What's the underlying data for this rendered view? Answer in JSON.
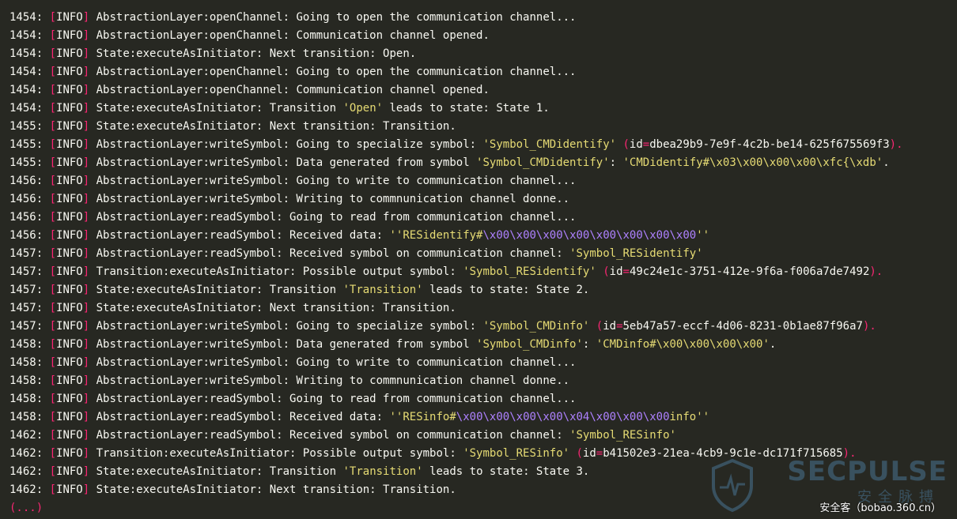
{
  "log_lines": [
    {
      "num": "1454",
      "level": "INFO",
      "segs": [
        {
          "t": "AbstractionLayer:openChannel: Going to open the communication channel...",
          "c": "plain"
        }
      ]
    },
    {
      "num": "1454",
      "level": "INFO",
      "segs": [
        {
          "t": "AbstractionLayer:openChannel: Communication channel opened.",
          "c": "plain"
        }
      ]
    },
    {
      "num": "1454",
      "level": "INFO",
      "segs": [
        {
          "t": "State:executeAsInitiator: Next transition: Open.",
          "c": "plain"
        }
      ]
    },
    {
      "num": "1454",
      "level": "INFO",
      "segs": [
        {
          "t": "AbstractionLayer:openChannel: Going to open the communication channel...",
          "c": "plain"
        }
      ]
    },
    {
      "num": "1454",
      "level": "INFO",
      "segs": [
        {
          "t": "AbstractionLayer:openChannel: Communication channel opened.",
          "c": "plain"
        }
      ]
    },
    {
      "num": "1454",
      "level": "INFO",
      "segs": [
        {
          "t": "State:executeAsInitiator: Transition ",
          "c": "plain"
        },
        {
          "t": "'Open'",
          "c": "str"
        },
        {
          "t": " leads to state: State 1.",
          "c": "plain"
        }
      ]
    },
    {
      "num": "1455",
      "level": "INFO",
      "segs": [
        {
          "t": "State:executeAsInitiator: Next transition: Transition.",
          "c": "plain"
        }
      ]
    },
    {
      "num": "1455",
      "level": "INFO",
      "segs": [
        {
          "t": "AbstractionLayer:writeSymbol: Going to specialize symbol: ",
          "c": "plain"
        },
        {
          "t": "'Symbol_CMDidentify'",
          "c": "str"
        },
        {
          "t": " (",
          "c": "par"
        },
        {
          "t": "id",
          "c": "plain"
        },
        {
          "t": "=",
          "c": "par"
        },
        {
          "t": "dbea29b9-7e9f-4c2b-be14-625f675569f3",
          "c": "plain"
        },
        {
          "t": ").",
          "c": "par"
        }
      ]
    },
    {
      "num": "1455",
      "level": "INFO",
      "segs": [
        {
          "t": "AbstractionLayer:writeSymbol: Data generated from symbol ",
          "c": "plain"
        },
        {
          "t": "'Symbol_CMDidentify'",
          "c": "str"
        },
        {
          "t": ": ",
          "c": "plain"
        },
        {
          "t": "'CMDidentify#\\x03\\x00\\x00\\x00\\xfc{\\xdb'",
          "c": "str"
        },
        {
          "t": ".",
          "c": "plain"
        }
      ]
    },
    {
      "num": "1456",
      "level": "INFO",
      "segs": [
        {
          "t": "AbstractionLayer:writeSymbol: Going to write to communication channel...",
          "c": "plain"
        }
      ]
    },
    {
      "num": "1456",
      "level": "INFO",
      "segs": [
        {
          "t": "AbstractionLayer:writeSymbol: Writing to commnunication channel donne..",
          "c": "plain"
        }
      ]
    },
    {
      "num": "1456",
      "level": "INFO",
      "segs": [
        {
          "t": "AbstractionLayer:readSymbol: Going to read from communication channel...",
          "c": "plain"
        }
      ]
    },
    {
      "num": "1456",
      "level": "INFO",
      "segs": [
        {
          "t": "AbstractionLayer:readSymbol: Received data: ",
          "c": "plain"
        },
        {
          "t": "''RESidentify#",
          "c": "str"
        },
        {
          "t": "\\x00\\x00\\x00\\x00\\x00\\x00\\x00\\x00",
          "c": "esc"
        },
        {
          "t": "''",
          "c": "str"
        }
      ]
    },
    {
      "num": "1457",
      "level": "INFO",
      "segs": [
        {
          "t": "AbstractionLayer:readSymbol: Received symbol on communication channel: ",
          "c": "plain"
        },
        {
          "t": "'Symbol_RESidentify'",
          "c": "str"
        }
      ]
    },
    {
      "num": "1457",
      "level": "INFO",
      "segs": [
        {
          "t": "Transition:executeAsInitiator: Possible output symbol: ",
          "c": "plain"
        },
        {
          "t": "'Symbol_RESidentify'",
          "c": "str"
        },
        {
          "t": " (",
          "c": "par"
        },
        {
          "t": "id",
          "c": "plain"
        },
        {
          "t": "=",
          "c": "par"
        },
        {
          "t": "49c24e1c-3751-412e-9f6a-f006a7de7492",
          "c": "plain"
        },
        {
          "t": ").",
          "c": "par"
        }
      ]
    },
    {
      "num": "1457",
      "level": "INFO",
      "segs": [
        {
          "t": "State:executeAsInitiator: Transition ",
          "c": "plain"
        },
        {
          "t": "'Transition'",
          "c": "str"
        },
        {
          "t": " leads to state: State 2.",
          "c": "plain"
        }
      ]
    },
    {
      "num": "1457",
      "level": "INFO",
      "segs": [
        {
          "t": "State:executeAsInitiator: Next transition: Transition.",
          "c": "plain"
        }
      ]
    },
    {
      "num": "1457",
      "level": "INFO",
      "segs": [
        {
          "t": "AbstractionLayer:writeSymbol: Going to specialize symbol: ",
          "c": "plain"
        },
        {
          "t": "'Symbol_CMDinfo'",
          "c": "str"
        },
        {
          "t": " (",
          "c": "par"
        },
        {
          "t": "id",
          "c": "plain"
        },
        {
          "t": "=",
          "c": "par"
        },
        {
          "t": "5eb47a57-eccf-4d06-8231-0b1ae87f96a7",
          "c": "plain"
        },
        {
          "t": ").",
          "c": "par"
        }
      ]
    },
    {
      "num": "1458",
      "level": "INFO",
      "segs": [
        {
          "t": "AbstractionLayer:writeSymbol: Data generated from symbol ",
          "c": "plain"
        },
        {
          "t": "'Symbol_CMDinfo'",
          "c": "str"
        },
        {
          "t": ": ",
          "c": "plain"
        },
        {
          "t": "'CMDinfo#\\x00\\x00\\x00\\x00'",
          "c": "str"
        },
        {
          "t": ".",
          "c": "plain"
        }
      ]
    },
    {
      "num": "1458",
      "level": "INFO",
      "segs": [
        {
          "t": "AbstractionLayer:writeSymbol: Going to write to communication channel...",
          "c": "plain"
        }
      ]
    },
    {
      "num": "1458",
      "level": "INFO",
      "segs": [
        {
          "t": "AbstractionLayer:writeSymbol: Writing to commnunication channel donne..",
          "c": "plain"
        }
      ]
    },
    {
      "num": "1458",
      "level": "INFO",
      "segs": [
        {
          "t": "AbstractionLayer:readSymbol: Going to read from communication channel...",
          "c": "plain"
        }
      ]
    },
    {
      "num": "1458",
      "level": "INFO",
      "segs": [
        {
          "t": "AbstractionLayer:readSymbol: Received data: ",
          "c": "plain"
        },
        {
          "t": "''RESinfo#",
          "c": "str"
        },
        {
          "t": "\\x00\\x00\\x00\\x00\\x04\\x00\\x00\\x00",
          "c": "esc"
        },
        {
          "t": "info''",
          "c": "str"
        }
      ]
    },
    {
      "num": "1462",
      "level": "INFO",
      "segs": [
        {
          "t": "AbstractionLayer:readSymbol: Received symbol on communication channel: ",
          "c": "plain"
        },
        {
          "t": "'Symbol_RESinfo'",
          "c": "str"
        }
      ]
    },
    {
      "num": "1462",
      "level": "INFO",
      "segs": [
        {
          "t": "Transition:executeAsInitiator: Possible output symbol: ",
          "c": "plain"
        },
        {
          "t": "'Symbol_RESinfo'",
          "c": "str"
        },
        {
          "t": " (",
          "c": "par"
        },
        {
          "t": "id",
          "c": "plain"
        },
        {
          "t": "=",
          "c": "par"
        },
        {
          "t": "b41502e3-21ea-4cb9-9c1e-dc171f715685",
          "c": "plain"
        },
        {
          "t": ").",
          "c": "par"
        }
      ]
    },
    {
      "num": "1462",
      "level": "INFO",
      "segs": [
        {
          "t": "State:executeAsInitiator: Transition ",
          "c": "plain"
        },
        {
          "t": "'Transition'",
          "c": "str"
        },
        {
          "t": " leads to state: State 3.",
          "c": "plain"
        }
      ]
    },
    {
      "num": "1462",
      "level": "INFO",
      "segs": [
        {
          "t": "State:executeAsInitiator: Next transition: Transition.",
          "c": "plain"
        }
      ]
    }
  ],
  "ellipsis": "(...)",
  "watermark": {
    "logo_text": "SECPULSE",
    "sub_text": "安全脉搏",
    "site_text": "安全客（bobao.360.cn）"
  },
  "colors": {
    "background": "#272822",
    "text": "#f8f8f2",
    "bracket": "#f92672",
    "string": "#e6db74",
    "escape": "#ae81ff"
  }
}
